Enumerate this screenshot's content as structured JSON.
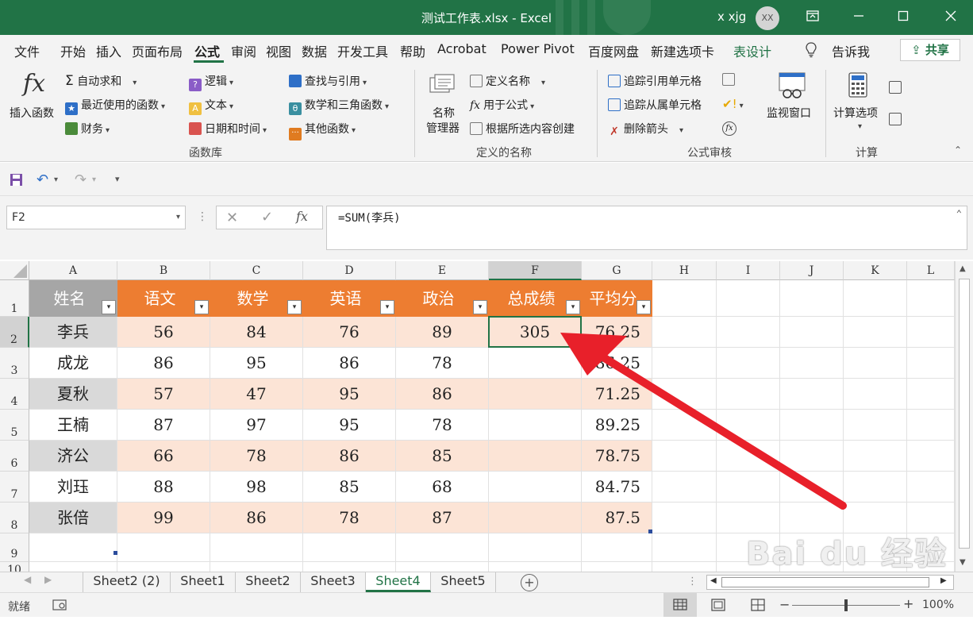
{
  "window": {
    "title": "测试工作表.xlsx  -  Excel",
    "user_name": "x xjg",
    "avatar_initials": "XX",
    "accent_color": "#217346"
  },
  "menu": {
    "items": [
      "文件",
      "开始",
      "插入",
      "页面布局",
      "公式",
      "审阅",
      "视图",
      "数据",
      "开发工具",
      "帮助",
      "Acrobat",
      "Power Pivot",
      "百度网盘",
      "新建选项卡",
      "表设计"
    ],
    "active": "公式",
    "tell_me": "告诉我",
    "share": "共享"
  },
  "ribbon": {
    "insert_function": "插入函数",
    "autosum": "自动求和",
    "recent": "最近使用的函数",
    "financial": "财务",
    "logical": "逻辑",
    "text": "文本",
    "datetime": "日期和时间",
    "lookup": "查找与引用",
    "math": "数学和三角函数",
    "more": "其他函数",
    "group_library": "函数库",
    "name_manager_1": "名称",
    "name_manager_2": "管理器",
    "define_name": "定义名称",
    "use_in_formula": "用于公式",
    "create_from_selection": "根据所选内容创建",
    "group_names": "定义的名称",
    "trace_precedents": "追踪引用单元格",
    "trace_dependents": "追踪从属单元格",
    "remove_arrows": "删除箭头",
    "watch_window": "监视窗口",
    "group_audit": "公式审核",
    "calc_options": "计算选项",
    "group_calc": "计算",
    "fx_glyph": "fx"
  },
  "formula_bar": {
    "name_box": "F2",
    "formula": "=SUM(李兵)",
    "fx_label": "fx"
  },
  "sheet": {
    "columns": [
      "A",
      "B",
      "C",
      "D",
      "E",
      "F",
      "G",
      "H",
      "I",
      "J",
      "K",
      "L"
    ],
    "rows": [
      "1",
      "2",
      "3",
      "4",
      "5",
      "6",
      "7",
      "8",
      "9",
      "10"
    ],
    "headers": [
      "姓名",
      "语文",
      "数学",
      "英语",
      "政治",
      "总成绩",
      "平均分"
    ],
    "data": [
      [
        "李兵",
        "56",
        "84",
        "76",
        "89",
        "305",
        "76.25"
      ],
      [
        "成龙",
        "86",
        "95",
        "86",
        "78",
        "",
        "86.25"
      ],
      [
        "夏秋",
        "57",
        "47",
        "95",
        "86",
        "",
        "71.25"
      ],
      [
        "王楠",
        "87",
        "97",
        "95",
        "78",
        "",
        "89.25"
      ],
      [
        "济公",
        "66",
        "78",
        "86",
        "85",
        "",
        "78.75"
      ],
      [
        "刘珏",
        "88",
        "98",
        "85",
        "68",
        "",
        "84.75"
      ],
      [
        "张倍",
        "99",
        "86",
        "78",
        "87",
        "",
        "87.5"
      ]
    ],
    "selected_cell": "F2",
    "header_color": "#ed7d31",
    "band_color": "#fce4d6"
  },
  "tabs": {
    "sheets": [
      "Sheet2 (2)",
      "Sheet1",
      "Sheet2",
      "Sheet3",
      "Sheet4",
      "Sheet5"
    ],
    "active": "Sheet4"
  },
  "status": {
    "ready": "就绪",
    "zoom": "100%"
  },
  "watermark": "Bai du 经验",
  "watermark_url": "jingyan.baidu.com"
}
